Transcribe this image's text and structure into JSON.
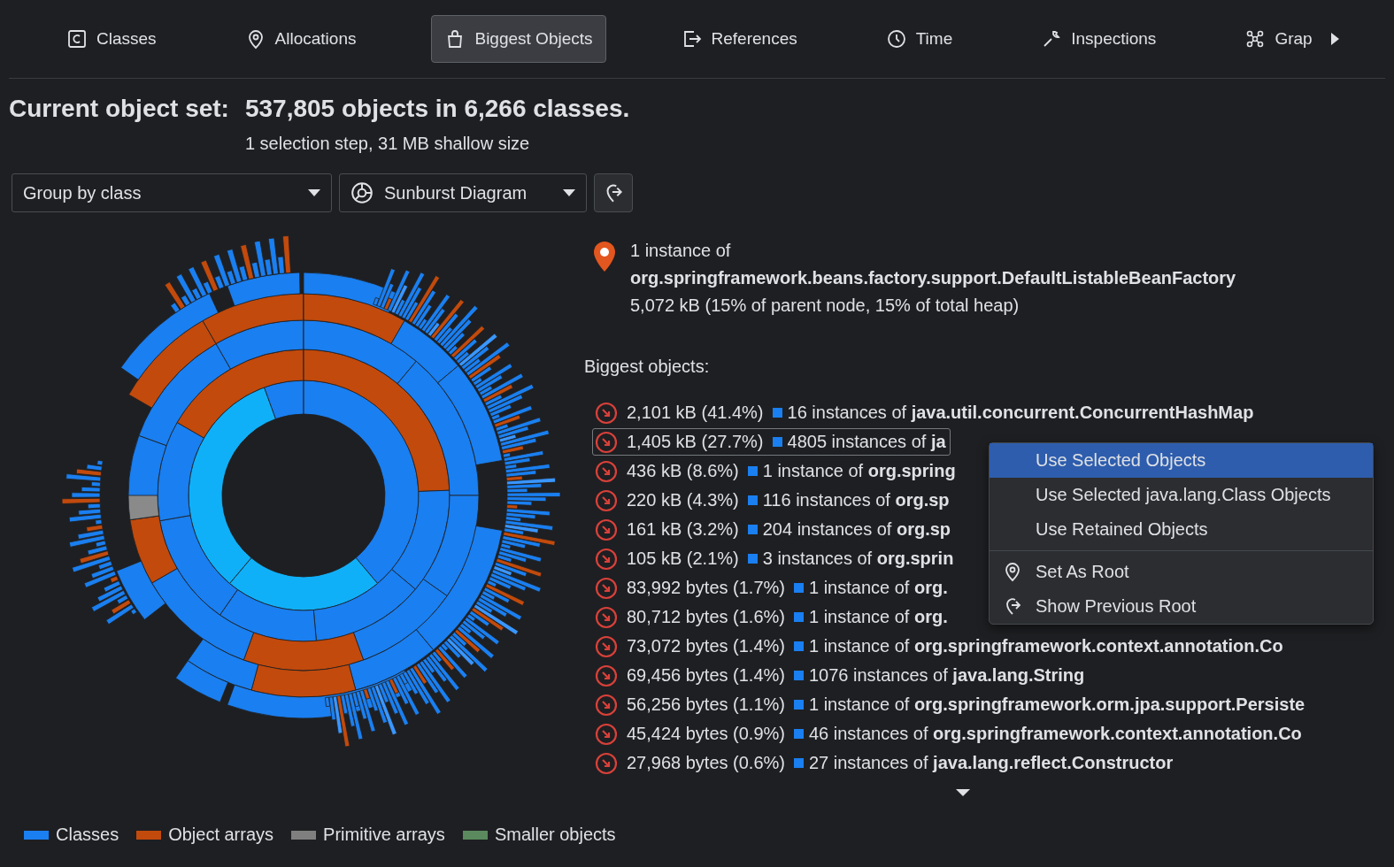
{
  "tabs": [
    {
      "label": "Classes",
      "selected": false
    },
    {
      "label": "Allocations",
      "selected": false
    },
    {
      "label": "Biggest Objects",
      "selected": true
    },
    {
      "label": "References",
      "selected": false
    },
    {
      "label": "Time",
      "selected": false
    },
    {
      "label": "Inspections",
      "selected": false
    },
    {
      "label": "Grap",
      "selected": false
    }
  ],
  "header": {
    "label": "Current object set:",
    "value": "537,805 objects in 6,266 classes.",
    "subtitle": "1 selection step, 31 MB shallow size"
  },
  "toolbar": {
    "grouping": "Group by class",
    "view": "Sunburst Diagram"
  },
  "selection": {
    "count": "1 instance of",
    "class": "org.springframework.beans.factory.support.DefaultListableBeanFactory",
    "size": "5,072 kB (15% of parent node, 15% of total heap)"
  },
  "biggest_label": "Biggest objects:",
  "objects": [
    {
      "size": "2,101 kB (41.4%)",
      "count": "16 instances of",
      "class": "java.util.concurrent.ConcurrentHashMap",
      "selected": false
    },
    {
      "size": "1,405 kB (27.7%)",
      "count": "4805 instances of",
      "class": "ja",
      "selected": true
    },
    {
      "size": "436 kB (8.6%)",
      "count": "1 instance of",
      "class": "org.spring",
      "selected": false
    },
    {
      "size": "220 kB (4.3%)",
      "count": "116 instances of",
      "class": "org.sp",
      "selected": false
    },
    {
      "size": "161 kB (3.2%)",
      "count": "204 instances of",
      "class": "org.sp",
      "selected": false
    },
    {
      "size": "105 kB (2.1%)",
      "count": "3 instances of",
      "class": "org.sprin",
      "selected": false
    },
    {
      "size": "83,992 bytes (1.7%)",
      "count": "1 instance of",
      "class": "org.",
      "selected": false
    },
    {
      "size": "80,712 bytes (1.6%)",
      "count": "1 instance of",
      "class": "org.",
      "selected": false
    },
    {
      "size": "73,072 bytes (1.4%)",
      "count": "1 instance of",
      "class": "org.springframework.context.annotation.Co",
      "selected": false
    },
    {
      "size": "69,456 bytes (1.4%)",
      "count": "1076 instances of",
      "class": "java.lang.String",
      "selected": false
    },
    {
      "size": "56,256 bytes (1.1%)",
      "count": "1 instance of",
      "class": "org.springframework.orm.jpa.support.Persiste",
      "selected": false
    },
    {
      "size": "45,424 bytes (0.9%)",
      "count": "46 instances of",
      "class": "org.springframework.context.annotation.Co",
      "selected": false
    },
    {
      "size": "27,968 bytes (0.6%)",
      "count": "27 instances of",
      "class": "java.lang.reflect.Constructor",
      "selected": false
    }
  ],
  "context_menu": {
    "groups": [
      [
        {
          "label": "Use Selected Objects",
          "selected": true,
          "kind": "plain"
        },
        {
          "label": "Use Selected java.lang.Class Objects",
          "selected": false,
          "kind": "plain"
        },
        {
          "label": "Use Retained Objects",
          "selected": false,
          "kind": "plain"
        }
      ],
      [
        {
          "label": "Set As Root",
          "selected": false,
          "kind": "pin"
        },
        {
          "label": "Show Previous Root",
          "selected": false,
          "kind": "back"
        }
      ]
    ]
  },
  "legend": [
    {
      "label": "Classes",
      "color": "#1a7ff0"
    },
    {
      "label": "Object arrays",
      "color": "#c24a0c"
    },
    {
      "label": "Primitive arrays",
      "color": "#7f7f7f"
    },
    {
      "label": "Smaller objects",
      "color": "#5a8a5e"
    }
  ]
}
